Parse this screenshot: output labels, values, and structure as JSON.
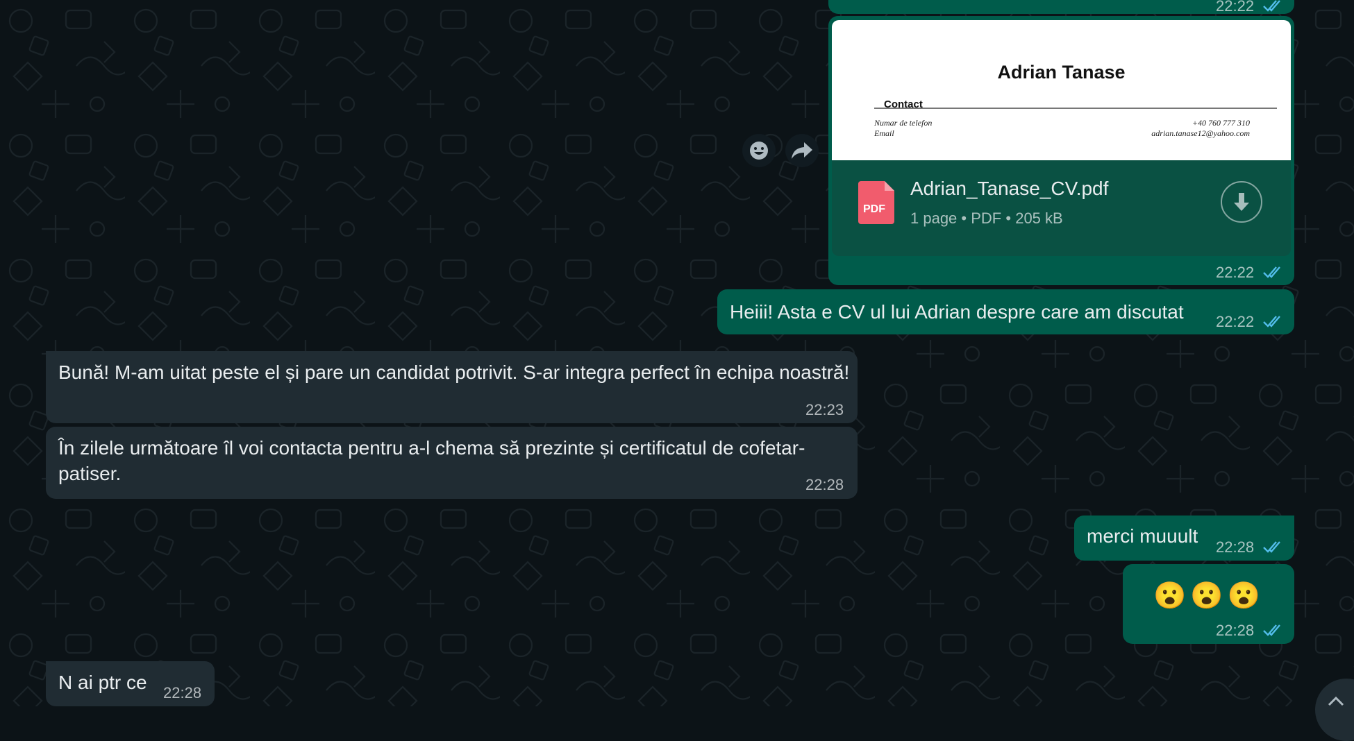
{
  "colors": {
    "background": "#0c1317",
    "outgoing_bubble": "#005c4b",
    "incoming_bubble": "#202c33",
    "read_ticks": "#53bdeb"
  },
  "top_partial_message": {
    "time": "22:22"
  },
  "document_message": {
    "preview": {
      "name": "Adrian Tanase",
      "section": "Contact",
      "phone_label": "Numar de telefon",
      "email_label": "Email",
      "phone_value": "+40 760 777 310",
      "email_value": "adrian.tanase12@yahoo.com"
    },
    "file_name": "Adrian_Tanase_CV.pdf",
    "pages": "1 page",
    "file_type": "PDF",
    "size": "205 kB",
    "pdf_icon_label": "PDF",
    "icon": "download-icon",
    "time": "22:22"
  },
  "hover_actions": {
    "react_icon": "emoji-smile-icon",
    "forward_icon": "forward-icon"
  },
  "messages": [
    {
      "direction": "out",
      "text": "Heiii! Asta e CV ul lui Adrian despre care am discutat",
      "time": "22:22"
    },
    {
      "direction": "in",
      "text": "Bună! M-am uitat peste el și pare un candidat potrivit. S-ar integra perfect în  echipa noastră!",
      "time": "22:23"
    },
    {
      "direction": "in",
      "text": "În zilele următoare îl voi contacta pentru a-l chema să prezinte și certificatul de cofetar-patiser.",
      "time": "22:28"
    },
    {
      "direction": "out",
      "text": "merci muuult",
      "time": "22:28"
    },
    {
      "direction": "out",
      "text": "😮😮😮",
      "time": "22:28"
    },
    {
      "direction": "in",
      "text": "N ai ptr ce",
      "time": "22:28"
    }
  ]
}
